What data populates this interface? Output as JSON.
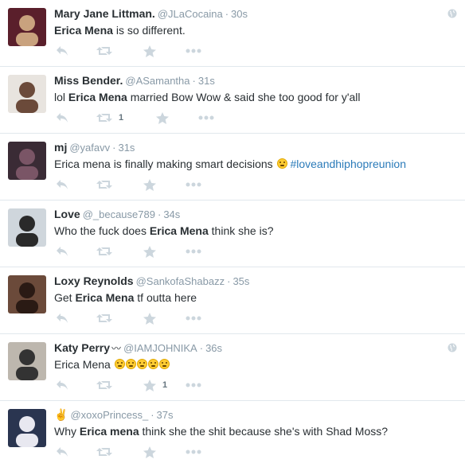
{
  "tweets": [
    {
      "name": "Mary Jane Littman.",
      "handle": "@JLaCocaina",
      "time": "30s",
      "text_parts": [
        {
          "t": "Erica Mena",
          "b": true
        },
        {
          "t": " is so different.",
          "b": false
        }
      ],
      "retweet_count": "",
      "fav_count": "",
      "globe": true,
      "avatar": "avatar-1"
    },
    {
      "name": "Miss Bender.",
      "handle": "@ASamantha",
      "time": "31s",
      "text_parts": [
        {
          "t": "lol ",
          "b": false
        },
        {
          "t": "Erica Mena",
          "b": true
        },
        {
          "t": " married Bow Wow & said she too good for y'all",
          "b": false
        }
      ],
      "retweet_count": "1",
      "fav_count": "",
      "globe": false,
      "avatar": "avatar-2"
    },
    {
      "name": "mj",
      "handle": "@yafavv",
      "time": "31s",
      "text_parts": [
        {
          "t": "Erica mena is finally making smart decisions ",
          "b": false
        },
        {
          "t": "😂",
          "b": false,
          "emoji": true
        },
        {
          "t": " ",
          "b": false
        },
        {
          "t": "#loveandhiphopreunion",
          "b": false,
          "tag": true
        }
      ],
      "retweet_count": "",
      "fav_count": "",
      "globe": false,
      "avatar": "avatar-3"
    },
    {
      "name": "Love",
      "handle": "@_because789",
      "time": "34s",
      "text_parts": [
        {
          "t": "Who the fuck does ",
          "b": false
        },
        {
          "t": "Erica Mena",
          "b": true
        },
        {
          "t": " think she is?",
          "b": false
        }
      ],
      "retweet_count": "",
      "fav_count": "",
      "globe": false,
      "avatar": "avatar-4"
    },
    {
      "name": "Loxy Reynolds",
      "handle": "@SankofaShabazz",
      "time": "35s",
      "text_parts": [
        {
          "t": "Get ",
          "b": false
        },
        {
          "t": "Erica Mena",
          "b": true
        },
        {
          "t": " tf outta here",
          "b": false
        }
      ],
      "retweet_count": "",
      "fav_count": "",
      "globe": false,
      "avatar": "avatar-5"
    },
    {
      "name": "Katy Perry",
      "name_emoji": "〰",
      "handle": "@IAMJOHNIKA",
      "time": "36s",
      "text_parts": [
        {
          "t": "Erica Mena ",
          "b": false
        },
        {
          "t": "😴😴😴😴😴",
          "b": false,
          "emoji": true
        }
      ],
      "retweet_count": "",
      "fav_count": "1",
      "globe": true,
      "avatar": "avatar-6"
    },
    {
      "name": "✌",
      "handle": "@xoxoPrincess_",
      "time": "37s",
      "text_parts": [
        {
          "t": "Why ",
          "b": false
        },
        {
          "t": "Erica mena",
          "b": true
        },
        {
          "t": " think she the shit because she's with Shad Moss?",
          "b": false
        }
      ],
      "retweet_count": "",
      "fav_count": "",
      "globe": false,
      "avatar": "avatar-7"
    }
  ],
  "separator": "·",
  "colors": {
    "link": "#2b7bb9",
    "meta": "#8899a6",
    "icon": "#ccd6dd",
    "border": "#e1e8ed"
  },
  "icons": {
    "reply": "reply-icon",
    "retweet": "retweet-icon",
    "favorite": "star-icon",
    "more": "more-dots-icon",
    "globe": "globe-icon"
  }
}
